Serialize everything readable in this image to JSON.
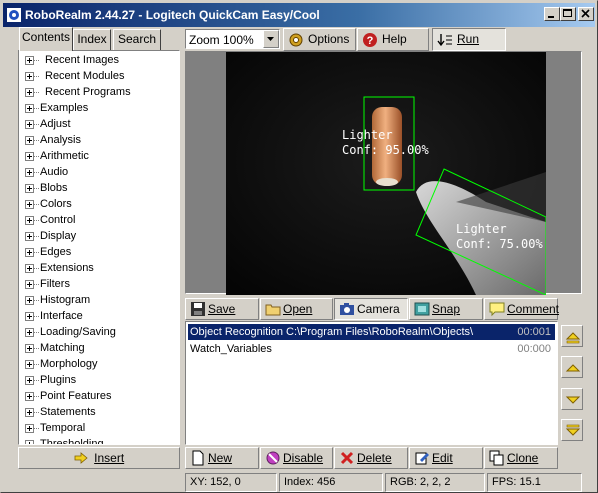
{
  "window": {
    "title": "RoboRealm 2.44.27 - Logitech QuickCam Easy/Cool"
  },
  "left_tabs": [
    {
      "label": "Contents"
    },
    {
      "label": "Index"
    },
    {
      "label": "Search"
    }
  ],
  "tree": {
    "items": [
      {
        "label": "Recent Images",
        "indent": true
      },
      {
        "label": "Recent Modules",
        "indent": true
      },
      {
        "label": "Recent Programs",
        "indent": true
      },
      {
        "label": "Examples"
      },
      {
        "label": "Adjust"
      },
      {
        "label": "Analysis"
      },
      {
        "label": "Arithmetic"
      },
      {
        "label": "Audio"
      },
      {
        "label": "Blobs"
      },
      {
        "label": "Colors"
      },
      {
        "label": "Control"
      },
      {
        "label": "Display"
      },
      {
        "label": "Edges"
      },
      {
        "label": "Extensions"
      },
      {
        "label": "Filters"
      },
      {
        "label": "Histogram"
      },
      {
        "label": "Interface"
      },
      {
        "label": "Loading/Saving"
      },
      {
        "label": "Matching"
      },
      {
        "label": "Morphology"
      },
      {
        "label": "Plugins"
      },
      {
        "label": "Point Features"
      },
      {
        "label": "Statements"
      },
      {
        "label": "Temporal"
      },
      {
        "label": "Thresholding"
      }
    ]
  },
  "insert_label": "Insert",
  "toolbar": {
    "zoom_value": "Zoom 100%",
    "options_label": "Options",
    "help_label": "Help",
    "run_label": "Run"
  },
  "video": {
    "detections": [
      {
        "object": "Lighter",
        "confidence": "Conf: 95.00%"
      },
      {
        "object": "Lighter",
        "confidence": "Conf: 75.00%"
      }
    ]
  },
  "pipeline_toolbar": {
    "save_label": "Save",
    "open_label": "Open",
    "camera_label": "Camera",
    "snap_label": "Snap",
    "comment_label": "Comment"
  },
  "pipeline": {
    "rows": [
      {
        "name": "Object Recognition C:\\Program Files\\RoboRealm\\Objects\\",
        "time": "00:001",
        "selected": true
      },
      {
        "name": "Watch_Variables",
        "time": "00:000",
        "selected": false
      }
    ]
  },
  "bottom_toolbar": {
    "new_label": "New",
    "disable_label": "Disable",
    "delete_label": "Delete",
    "edit_label": "Edit",
    "clone_label": "Clone"
  },
  "status": {
    "xy": "XY: 152, 0",
    "index": "Index: 456",
    "rgb": "RGB: 2, 2, 2",
    "fps": "FPS: 15.1"
  },
  "colors": {
    "titlebar_start": "#0a246a",
    "selection": "#0a246a",
    "detection_box": "#00ff00",
    "face": "#d4d0c8"
  },
  "icons": {
    "app": "roborealm-icon",
    "options": "gear-icon",
    "help": "help-icon",
    "run": "run-icon",
    "save": "floppy-icon",
    "open": "folder-icon",
    "camera": "camera-icon",
    "snap": "snap-icon",
    "comment": "comment-icon",
    "new": "new-document-icon",
    "disable": "disable-icon",
    "delete": "delete-x-icon",
    "edit": "edit-icon",
    "clone": "clone-icon"
  }
}
